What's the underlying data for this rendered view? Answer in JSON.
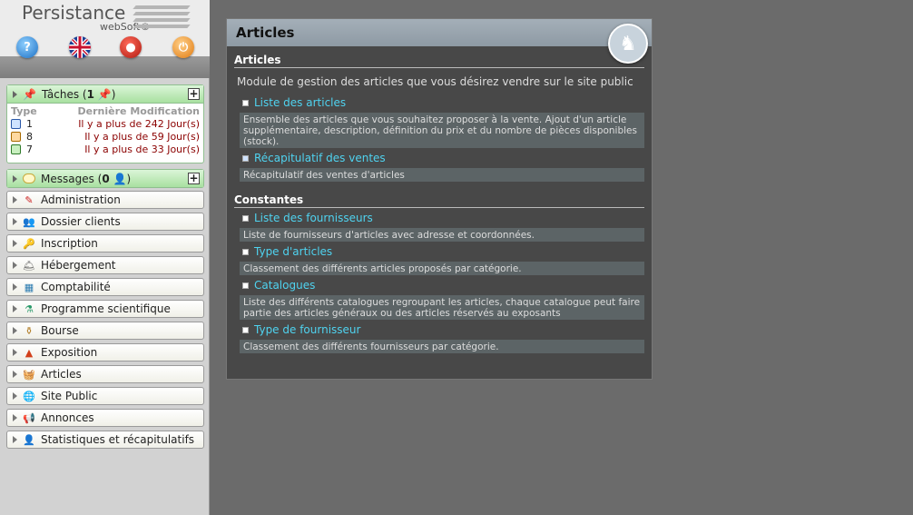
{
  "logo": {
    "name": "Persistance",
    "sub": "webSoft©"
  },
  "tasks": {
    "title": "Tâches",
    "count": "1",
    "header_type": "Type",
    "header_modified": "Dernière Modification",
    "rows": [
      {
        "num": "1",
        "desc": "Il y a plus de 242 Jour(s)"
      },
      {
        "num": "8",
        "desc": "Il y a plus de 59 Jour(s)"
      },
      {
        "num": "7",
        "desc": "Il y a plus de 33 Jour(s)"
      }
    ]
  },
  "messages": {
    "title": "Messages",
    "count": "0"
  },
  "menu": [
    {
      "label": "Administration"
    },
    {
      "label": "Dossier clients"
    },
    {
      "label": "Inscription"
    },
    {
      "label": "Hébergement"
    },
    {
      "label": "Comptabilité"
    },
    {
      "label": "Programme scientifique"
    },
    {
      "label": "Bourse"
    },
    {
      "label": "Exposition"
    },
    {
      "label": "Articles"
    },
    {
      "label": "Site Public"
    },
    {
      "label": "Annonces"
    },
    {
      "label": "Statistiques et récapitulatifs"
    }
  ],
  "main": {
    "title": "Articles",
    "section1": "Articles",
    "intro": "Module de gestion des articles que vous désirez vendre sur le site public",
    "items1": [
      {
        "link": "Liste des articles",
        "desc": "Ensemble des articles que vous souhaitez proposer à la vente. Ajout d'un article supplémentaire, description, définition du prix et du nombre de pièces disponibles (stock)."
      },
      {
        "link": "Récapitulatif des ventes",
        "desc": "Récapitulatif des ventes d'articles"
      }
    ],
    "section2": "Constantes",
    "items2": [
      {
        "link": "Liste des fournisseurs",
        "desc": "Liste de fournisseurs d'articles avec adresse et coordonnées."
      },
      {
        "link": "Type d'articles",
        "desc": "Classement des différents articles proposés par catégorie."
      },
      {
        "link": "Catalogues",
        "desc": "Liste des différents catalogues regroupant les articles, chaque catalogue peut faire partie des articles généraux ou des articles réservés au exposants"
      },
      {
        "link": "Type de fournisseur",
        "desc": "Classement des différents fournisseurs par catégorie."
      }
    ]
  }
}
